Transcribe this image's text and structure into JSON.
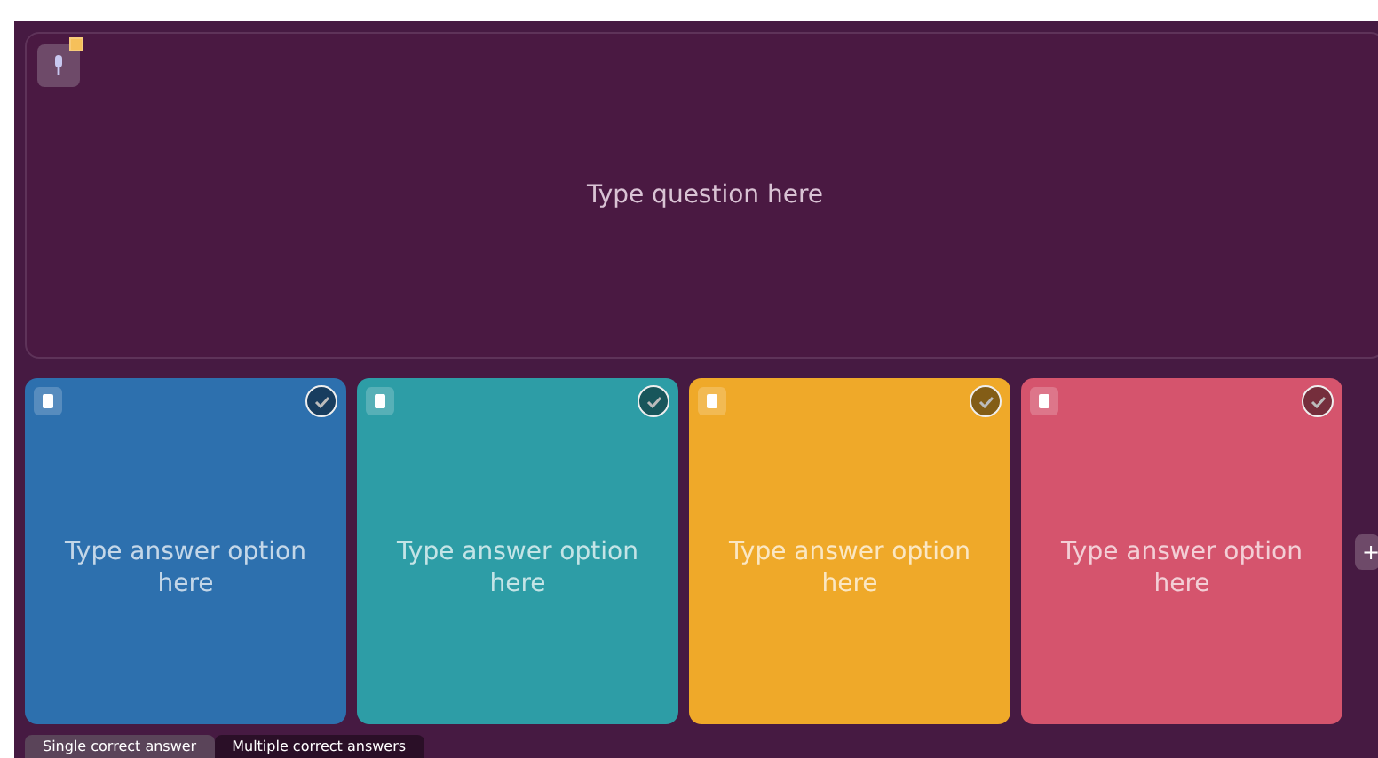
{
  "question": {
    "placeholder": "Type question here"
  },
  "answers": [
    {
      "placeholder": "Type answer option here",
      "color": "#2d70ae"
    },
    {
      "placeholder": "Type answer option here",
      "color": "#2d9da6"
    },
    {
      "placeholder": "Type answer option here",
      "color": "#efa929"
    },
    {
      "placeholder": "Type answer option here",
      "color": "#d5546d"
    }
  ],
  "add_button": "+",
  "answer_modes": [
    {
      "label": "Single correct answer",
      "selected": true
    },
    {
      "label": "Multiple correct answers",
      "selected": false
    }
  ]
}
